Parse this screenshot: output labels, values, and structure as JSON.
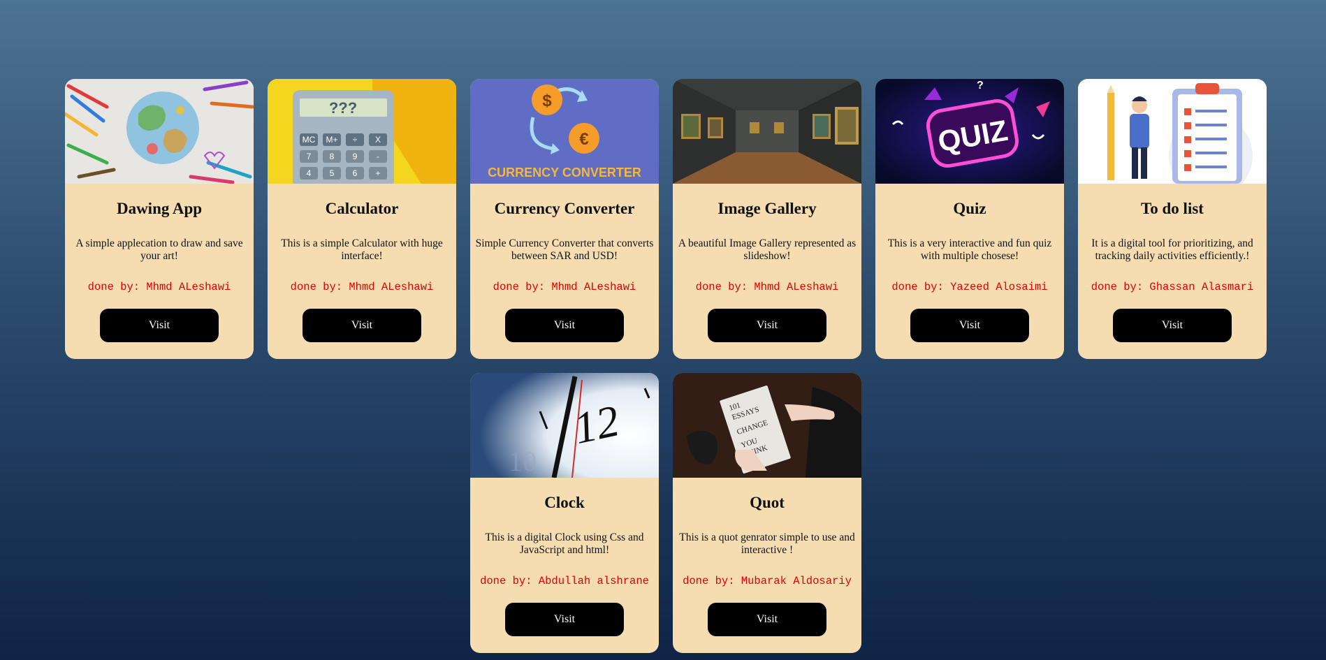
{
  "projects": [
    {
      "title": "Dawing App",
      "description": "A simple applecation to draw and save your art!",
      "author": "done by: Mhmd ALeshawi",
      "button": "Visit",
      "image": "drawing-globe-image"
    },
    {
      "title": "Calculator",
      "description": "This is a simple Calculator with huge interface!",
      "author": "done by: Mhmd ALeshawi",
      "button": "Visit",
      "image": "calculator-image",
      "image_text": "???",
      "keys": [
        "MC",
        "M+",
        "÷",
        "X",
        "7",
        "8",
        "9",
        "-",
        "4",
        "5",
        "6",
        "+"
      ]
    },
    {
      "title": "Currency Converter",
      "description": "Simple Currency Converter that converts between SAR and USD!",
      "author": "done by: Mhmd ALeshawi",
      "button": "Visit",
      "image": "currency-converter-image",
      "image_text": "CURRENCY CONVERTER",
      "symbols": [
        "$",
        "€"
      ]
    },
    {
      "title": "Image Gallery",
      "description": "A beautiful Image Gallery represented as slideshow!",
      "author": "done by: Mhmd ALeshawi",
      "button": "Visit",
      "image": "gallery-room-image"
    },
    {
      "title": "Quiz",
      "description": "This is a very interactive and fun quiz with multiple chosese!",
      "author": "done by: Yazeed Alosaimi",
      "button": "Visit",
      "image": "quiz-neon-image",
      "image_text": "QUIZ"
    },
    {
      "title": "To do list",
      "description": "It is a digital tool for prioritizing, and tracking daily activities efficiently.!",
      "author": "done by: Ghassan Alasmari",
      "button": "Visit",
      "image": "todo-clipboard-image"
    },
    {
      "title": "Clock",
      "description": "This is a digital Clock using Css and JavaScript and html!",
      "author": "done by: Abdullah alshrane",
      "button": "Visit",
      "image": "clock-face-image",
      "image_text": "12"
    },
    {
      "title": "Quot",
      "description": "This is a quot genrator simple to use and interactive !",
      "author": "done by: Mubarak Aldosariy",
      "button": "Visit",
      "image": "book-in-hands-image",
      "image_text": [
        "101",
        "ESSAYS",
        "CHANGE",
        "YOU",
        "THINK"
      ]
    }
  ],
  "colors": {
    "card": "#f5dcb1",
    "author": "#e00000",
    "button": "#000000"
  }
}
